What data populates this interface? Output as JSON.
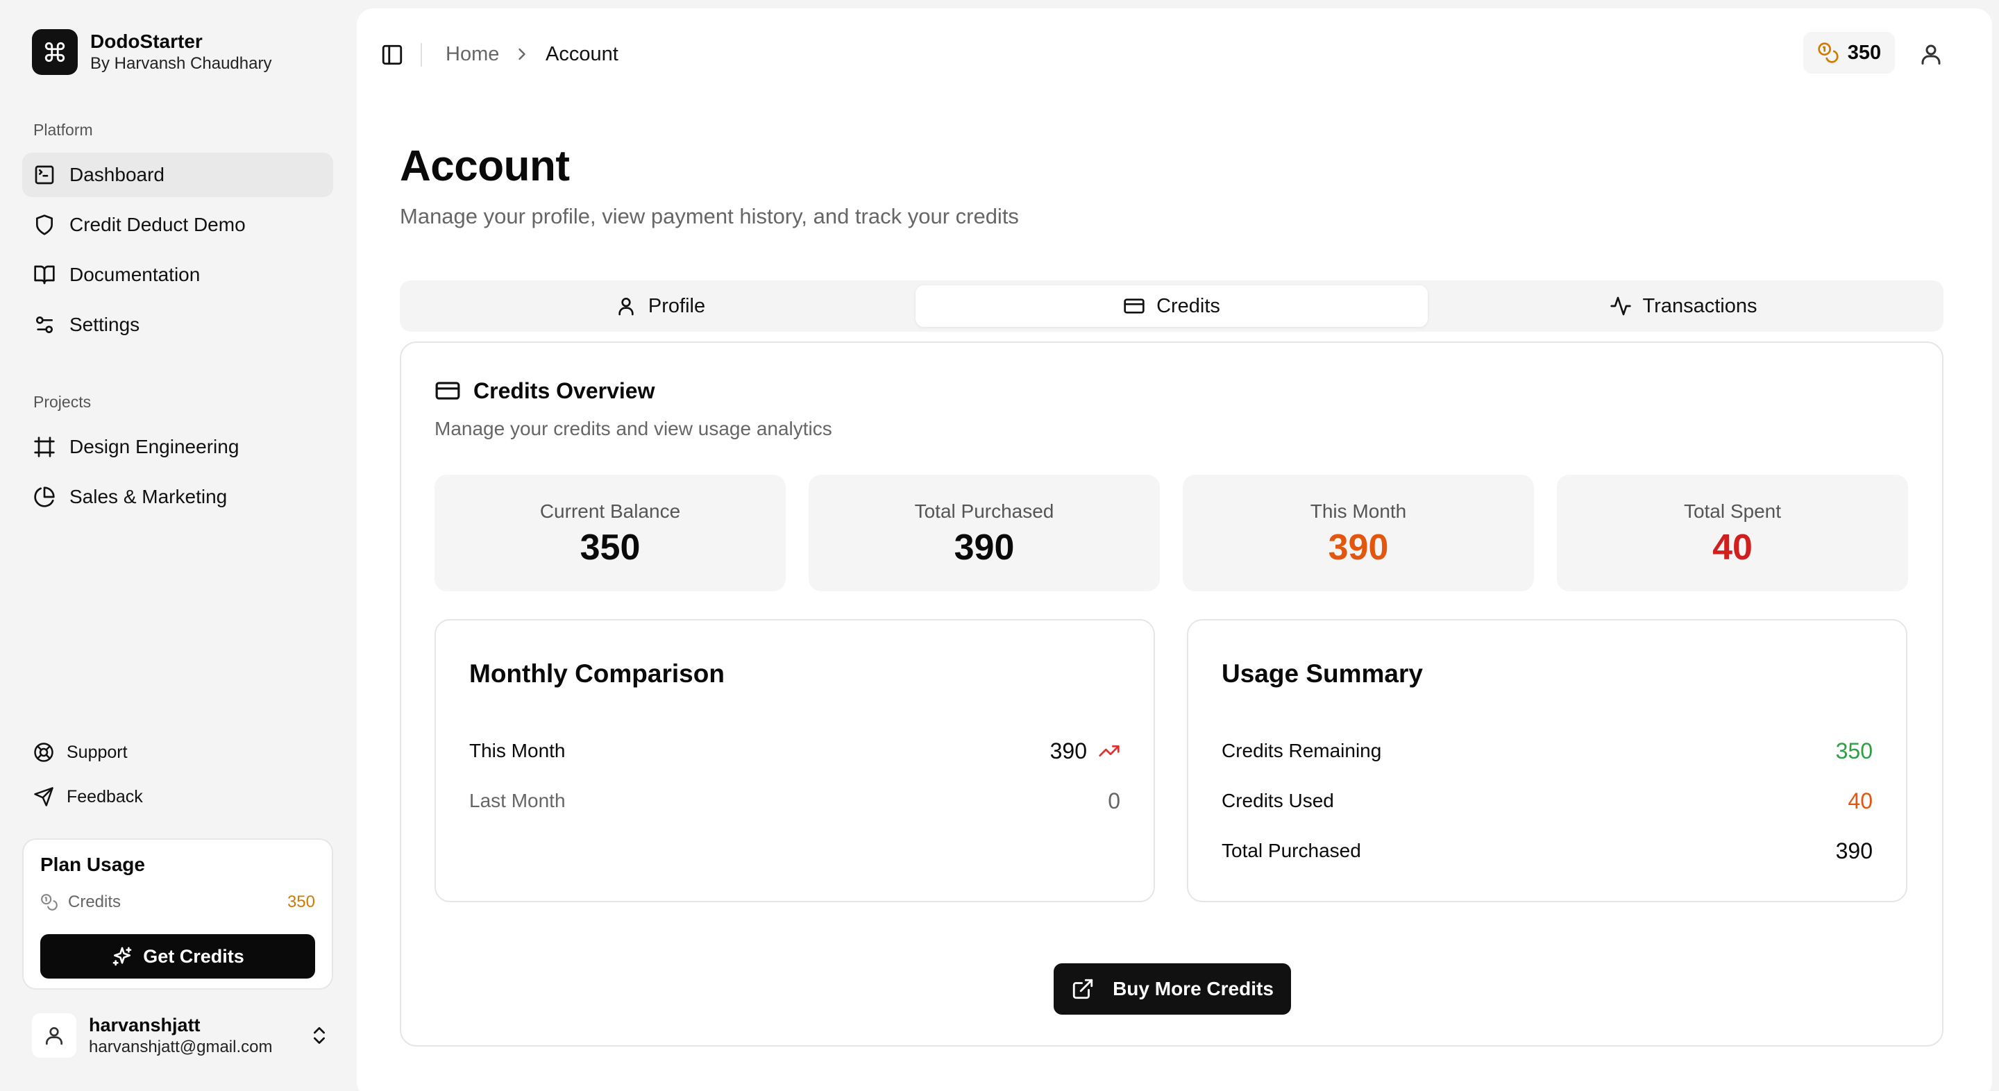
{
  "brand": {
    "name": "DodoStarter",
    "subtitle": "By Harvansh Chaudhary"
  },
  "sidebar": {
    "platform_label": "Platform",
    "platform_items": [
      {
        "label": "Dashboard",
        "icon": "terminal-square-icon",
        "active": true
      },
      {
        "label": "Credit Deduct Demo",
        "icon": "shield-icon"
      },
      {
        "label": "Documentation",
        "icon": "book-open-icon"
      },
      {
        "label": "Settings",
        "icon": "sliders-icon"
      }
    ],
    "projects_label": "Projects",
    "project_items": [
      {
        "label": "Design Engineering",
        "icon": "frame-icon"
      },
      {
        "label": "Sales & Marketing",
        "icon": "pie-chart-icon"
      }
    ],
    "support_label": "Support",
    "feedback_label": "Feedback"
  },
  "plan": {
    "title": "Plan Usage",
    "credits_label": "Credits",
    "credits_value": "350",
    "button_label": "Get Credits"
  },
  "user": {
    "name": "harvanshjatt",
    "email": "harvanshjatt@gmail.com"
  },
  "topbar": {
    "breadcrumb_home": "Home",
    "breadcrumb_current": "Account",
    "credit_balance": "350"
  },
  "page": {
    "title": "Account",
    "subtitle": "Manage your profile, view payment history, and track your credits"
  },
  "tabs": [
    {
      "label": "Profile",
      "icon": "user-icon"
    },
    {
      "label": "Credits",
      "icon": "credit-card-icon",
      "active": true
    },
    {
      "label": "Transactions",
      "icon": "activity-icon"
    }
  ],
  "overview": {
    "title": "Credits Overview",
    "subtitle": "Manage your credits and view usage analytics",
    "stats": [
      {
        "label": "Current Balance",
        "value": "350",
        "color": "#0a0a0a"
      },
      {
        "label": "Total Purchased",
        "value": "390",
        "color": "#0a0a0a"
      },
      {
        "label": "This Month",
        "value": "390",
        "color": "#e2570f"
      },
      {
        "label": "Total Spent",
        "value": "40",
        "color": "#d11f1f"
      }
    ]
  },
  "monthly": {
    "title": "Monthly Comparison",
    "this_month_label": "This Month",
    "this_month_value": "390",
    "last_month_label": "Last Month",
    "last_month_value": "0"
  },
  "usage": {
    "title": "Usage Summary",
    "rows": [
      {
        "label": "Credits Remaining",
        "value": "350",
        "color": "#2f9e44"
      },
      {
        "label": "Credits Used",
        "value": "40",
        "color": "#e2570f"
      },
      {
        "label": "Total Purchased",
        "value": "390",
        "color": "#0a0a0a"
      }
    ]
  },
  "buy_button": "Buy More Credits"
}
